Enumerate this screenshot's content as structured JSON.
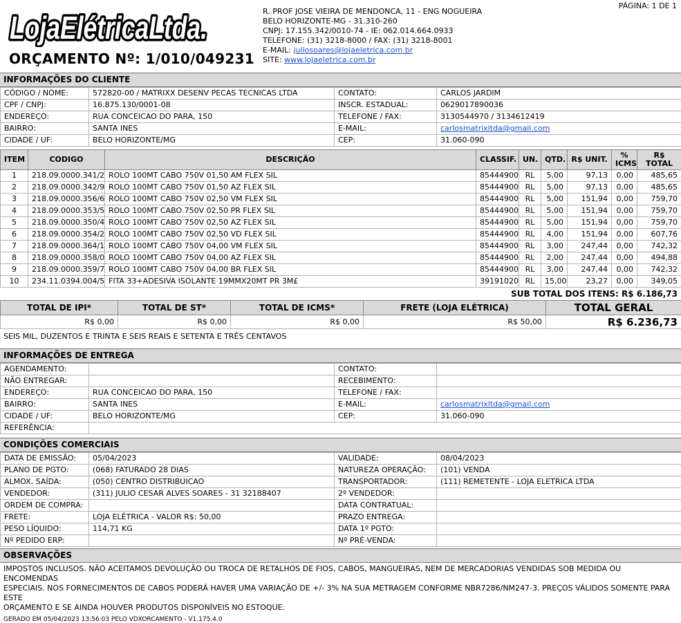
{
  "header": {
    "page_label": "PÁGINA: 1 DE 1",
    "logo_text": "LojaElétricaLtda.",
    "quote_title": "ORÇAMENTO Nº: 1/010/049231",
    "company": {
      "address": "R. PROF JOSE VIEIRA DE MENDONCA, 11 - ENG NOGUEIRA",
      "city": "BELO HORIZONTE-MG - 31.310-260",
      "ids": "CNPJ: 17.155.342/0010-74 - IE: 062.014.664.0933",
      "phones": "TELEFONE: (31) 3218-8000 / FAX: (31) 3218-8001",
      "email_label": "E-MAIL: ",
      "email": "juliosoares@lojaeletrica.com.br",
      "site_label": "SITE: ",
      "site": "www.lojaeletrica.com.br"
    }
  },
  "client": {
    "title": "INFORMAÇÕES DO CLIENTE",
    "rows": [
      {
        "l1": "CÓDIGO / NOME:",
        "v1": "572820-00 / MATRIXX DESENV PECAS TECNICAS LTDA",
        "l2": "CONTATO:",
        "v2": "CARLOS JARDIM"
      },
      {
        "l1": "CPF / CNPJ:",
        "v1": "16.875.130/0001-08",
        "l2": "INSCR. ESTADUAL:",
        "v2": "0629017890036"
      },
      {
        "l1": "ENDEREÇO:",
        "v1": "RUA CONCEICAO DO PARA, 150",
        "l2": "TELEFONE / FAX:",
        "v2": "3130544970 / 3134612419"
      },
      {
        "l1": "BAIRRO:",
        "v1": "SANTA INES",
        "l2": "E-MAIL:",
        "v2": "carlosmatrixltda@gmail.com"
      },
      {
        "l1": "CIDADE / UF:",
        "v1": "BELO HORIZONTE/MG",
        "l2": "CEP:",
        "v2": "31.060-090"
      }
    ]
  },
  "items": {
    "headers": {
      "item": "ITEM",
      "codigo": "CODIGO",
      "descricao": "DESCRIÇÃO",
      "classif": "CLASSIF.",
      "un": "UN.",
      "qtd": "QTD.",
      "unit": "R$ UNIT.",
      "icms_1": "%",
      "icms_2": "ICMS",
      "total_1": "R$",
      "total_2": "TOTAL"
    },
    "rows": [
      {
        "item": "1",
        "codigo": "218.09.0000.341/2",
        "descricao": "ROLO 100MT CABO 750V 01,50 AM FLEX SIL",
        "classif": "85444900",
        "un": "RL",
        "qtd": "5,00",
        "unit": "97,13",
        "icms": "0,00",
        "total": "485,65"
      },
      {
        "item": "2",
        "codigo": "218.09.0000.342/9",
        "descricao": "ROLO 100MT CABO 750V 01,50 AZ FLEX SIL",
        "classif": "85444900",
        "un": "RL",
        "qtd": "5,00",
        "unit": "97,13",
        "icms": "0,00",
        "total": "485,65"
      },
      {
        "item": "3",
        "codigo": "218.09.0000.356/6",
        "descricao": "ROLO 100MT CABO 750V 02,50 VM FLEX SIL",
        "classif": "85444900",
        "un": "RL",
        "qtd": "5,00",
        "unit": "151,94",
        "icms": "0,00",
        "total": "759,70"
      },
      {
        "item": "4",
        "codigo": "218.09.0000.353/5",
        "descricao": "ROLO 100MT CABO 750V 02,50 PR FLEX SIL",
        "classif": "85444900",
        "un": "RL",
        "qtd": "5,00",
        "unit": "151,94",
        "icms": "0,00",
        "total": "759,70"
      },
      {
        "item": "5",
        "codigo": "218.09.0000.350/4",
        "descricao": "ROLO 100MT CABO 750V 02,50 AZ FLEX SIL",
        "classif": "85444900",
        "un": "RL",
        "qtd": "5,00",
        "unit": "151,94",
        "icms": "0,00",
        "total": "759,70"
      },
      {
        "item": "6",
        "codigo": "218.09.0000.354/2",
        "descricao": "ROLO 100MT CABO 750V 02,50 VD FLEX SIL",
        "classif": "85444900",
        "un": "RL",
        "qtd": "4,00",
        "unit": "151,94",
        "icms": "0,00",
        "total": "607,76"
      },
      {
        "item": "7",
        "codigo": "218.09.0000.364/1",
        "descricao": "ROLO 100MT CABO 750V 04,00 VM FLEX SIL",
        "classif": "85444900",
        "un": "RL",
        "qtd": "3,00",
        "unit": "247,44",
        "icms": "0,00",
        "total": "742,32"
      },
      {
        "item": "8",
        "codigo": "218.09.0000.358/0",
        "descricao": "ROLO 100MT CABO 750V 04,00 AZ FLEX SIL",
        "classif": "85444900",
        "un": "RL",
        "qtd": "2,00",
        "unit": "247,44",
        "icms": "0,00",
        "total": "494,88"
      },
      {
        "item": "9",
        "codigo": "218.09.0000.359/7",
        "descricao": "ROLO 100MT CABO 750V 04,00 BR FLEX SIL",
        "classif": "85444900",
        "un": "RL",
        "qtd": "3,00",
        "unit": "247,44",
        "icms": "0,00",
        "total": "742,32"
      },
      {
        "item": "10",
        "codigo": "234.11.0394.004/5",
        "descricao": "FITA 33+ADESIVA ISOLANTE 19MMX20MT PR 3M£",
        "classif": "39191020",
        "un": "RL",
        "qtd": "15,00",
        "unit": "23,27",
        "icms": "0,00",
        "total": "349,05"
      }
    ],
    "subtotal": "SUB TOTAL DOS ITENS: R$ 6.186,73"
  },
  "totals": {
    "ipi_label": "TOTAL DE IPI*",
    "ipi": "R$ 0,00",
    "st_label": "TOTAL DE ST*",
    "st": "R$ 0,00",
    "icms_label": "TOTAL DE ICMS*",
    "icms": "R$ 0,00",
    "frete_label": "FRETE (LOJA ELÉTRICA)",
    "frete": "R$ 50,00",
    "geral_label": "TOTAL GERAL",
    "geral": "R$ 6.236,73",
    "extenso": "SEIS MIL, DUZENTOS E TRINTA E SEIS REAIS E SETENTA E TRÊS CENTAVOS"
  },
  "delivery": {
    "title": "INFORMAÇÕES DE ENTREGA",
    "rows": [
      {
        "l1": "AGENDAMENTO:",
        "v1": "",
        "l2": "CONTATO:",
        "v2": ""
      },
      {
        "l1": "NÃO ENTREGAR:",
        "v1": "",
        "l2": "RECEBIMENTO:",
        "v2": ""
      },
      {
        "l1": "ENDEREÇO:",
        "v1": "RUA CONCEICAO DO PARA, 150",
        "l2": "TELEFONE / FAX:",
        "v2": ""
      },
      {
        "l1": "BAIRRO:",
        "v1": "SANTA INES",
        "l2": "E-MAIL:",
        "v2": "carlosmatrixltda@gmail.com"
      },
      {
        "l1": "CIDADE / UF:",
        "v1": "BELO HORIZONTE/MG",
        "l2": "CEP:",
        "v2": "31.060-090"
      }
    ],
    "ref_label": "REFERÊNCIA:",
    "ref_value": ""
  },
  "commercial": {
    "title": "CONDIÇÕES COMERCIAIS",
    "rows": [
      {
        "l1": "DATA DE EMISSÃO:",
        "v1": "05/04/2023",
        "l2": "VALIDADE:",
        "v2": "08/04/2023"
      },
      {
        "l1": "PLANO DE PGTO:",
        "v1": "(068) FATURADO 28 DIAS",
        "l2": "NATUREZA OPERAÇÃO:",
        "v2": "(101) VENDA"
      },
      {
        "l1": "ALMOX. SAÍDA:",
        "v1": "(050) CENTRO DISTRIBUICAO",
        "l2": "TRANSPORTADOR:",
        "v2": "(111) REMETENTE - LOJA ELETRICA LTDA"
      },
      {
        "l1": "VENDEDOR:",
        "v1": "(311) JULIO CESAR ALVES SOARES - 31 32188407",
        "l2": "2º VENDEDOR:",
        "v2": ""
      },
      {
        "l1": "ORDEM DE COMPRA:",
        "v1": "",
        "l2": "DATA CONTRATUAL:",
        "v2": ""
      },
      {
        "l1": "FRETE:",
        "v1": "LOJA ELÉTRICA - VALOR R$: 50,00",
        "l2": "PRAZO ENTREGA:",
        "v2": ""
      },
      {
        "l1": "PESO LÍQUIDO:",
        "v1": "114,71 KG",
        "l2": "DATA 1º PGTO:",
        "v2": ""
      },
      {
        "l1": "Nº PEDIDO ERP:",
        "v1": "",
        "l2": "Nº PRÉ-VENDA:",
        "v2": ""
      }
    ]
  },
  "observations": {
    "title": "OBSERVAÇÕES",
    "line1": "IMPOSTOS INCLUSOS. NÃO ACEITAMOS DEVOLUÇÃO OU TROCA DE RETALHOS DE FIOS, CABOS, MANGUEIRAS, NEM DE MERCADORIAS VENDIDAS SOB MEDIDA OU ENCOMENDAS",
    "line2": "ESPECIAIS. NOS FORNECIMENTOS DE CABOS PODERÁ HAVER UMA VARIAÇÃO DE +/- 3% NA SUA METRAGEM CONFORME NBR7286/NM247-3. PREÇOS VÁLIDOS SOMENTE PARA ESTE",
    "line3": "ORÇAMENTO E SE AINDA HOUVER PRODUTOS DISPONÍVEIS NO ESTOQUE."
  },
  "footer": "GERADO EM 05/04/2023 13:56:03 PELO VDXORCAMENTO - V1.175.4.0"
}
